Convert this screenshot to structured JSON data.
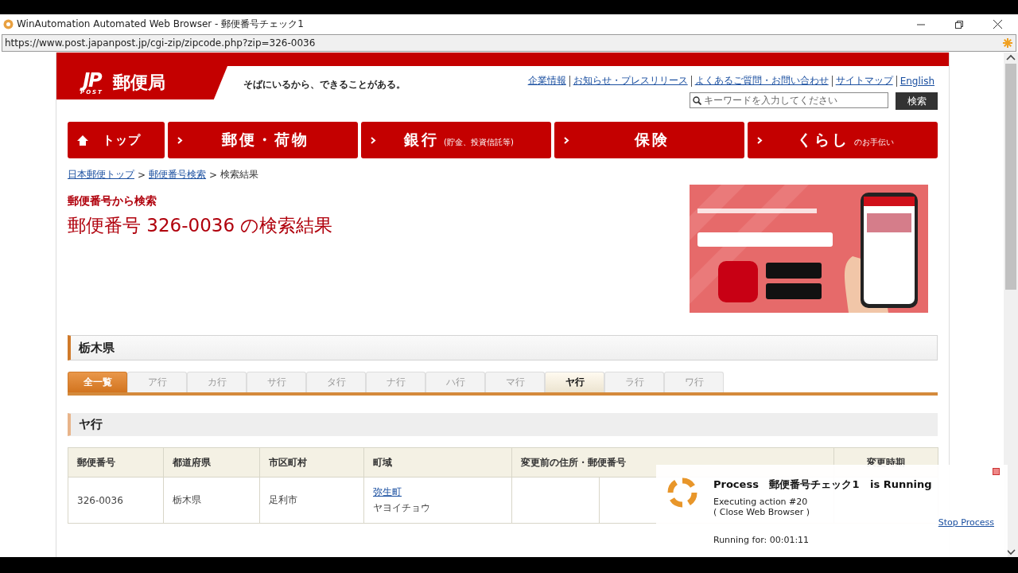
{
  "window": {
    "title": "WinAutomation Automated Web Browser - 郵便番号チェック1",
    "url": "https://www.post.japanpost.jp/cgi-zip/zipcode.php?zip=326-0036"
  },
  "header": {
    "logo_mark": "JP",
    "logo_sub": "POST",
    "logo_text": "郵便局",
    "tagline": "そばにいるから、できることがある。",
    "links": [
      "企業情報",
      "お知らせ・プレスリリース",
      "よくあるご質問・お問い合わせ",
      "サイトマップ",
      "English"
    ],
    "search": {
      "placeholder": "キーワードを入力してください",
      "button": "検索"
    }
  },
  "nav": [
    {
      "kind": "home",
      "label": "トップ"
    },
    {
      "kind": "menu",
      "label": "郵便・荷物"
    },
    {
      "kind": "menu",
      "label": "銀行",
      "sub": "(貯金、投資信託等)"
    },
    {
      "kind": "menu",
      "label": "保険"
    },
    {
      "kind": "menu",
      "label": "くらし",
      "sub": "のお手伝い"
    }
  ],
  "breadcrumb": [
    {
      "kind": "link",
      "label": "日本郵便トップ"
    },
    {
      "kind": "separator",
      "label": ">"
    },
    {
      "kind": "link",
      "label": "郵便番号検索"
    },
    {
      "kind": "separator",
      "label": ">"
    },
    {
      "kind": "current",
      "label": "検索結果"
    }
  ],
  "search_heading": "郵便番号から検索",
  "result_title": "郵便番号 326-0036 の検索結果",
  "prefecture": "栃木県",
  "kana_tabs": [
    {
      "kind": "all",
      "label": "全一覧",
      "selected": false
    },
    {
      "kind": "kana",
      "label": "ア行",
      "selected": false
    },
    {
      "kind": "kana",
      "label": "カ行",
      "selected": false
    },
    {
      "kind": "kana",
      "label": "サ行",
      "selected": false
    },
    {
      "kind": "kana",
      "label": "タ行",
      "selected": false
    },
    {
      "kind": "kana",
      "label": "ナ行",
      "selected": false
    },
    {
      "kind": "kana",
      "label": "ハ行",
      "selected": false
    },
    {
      "kind": "kana",
      "label": "マ行",
      "selected": false
    },
    {
      "kind": "kana",
      "label": "ヤ行",
      "selected": true
    },
    {
      "kind": "kana",
      "label": "ラ行",
      "selected": false
    },
    {
      "kind": "kana",
      "label": "ワ行",
      "selected": false
    }
  ],
  "section_title": "ヤ行",
  "table": {
    "columns": [
      "郵便番号",
      "都道府県",
      "市区町村",
      "町域",
      "変更前の住所・郵便番号",
      "変更時期"
    ],
    "rows": [
      {
        "postal": "326-0036",
        "prefecture": "栃木県",
        "city": "足利市",
        "town": "弥生町",
        "town_reading": "ヤヨイチョウ"
      }
    ]
  },
  "popup": {
    "label": "Process",
    "name": "郵便番号チェック1",
    "status": "is Running",
    "action": "Executing action #20",
    "detail": "( Close Web Browser )",
    "running": "Running for: 00:01:11",
    "stop": "Stop Process"
  }
}
